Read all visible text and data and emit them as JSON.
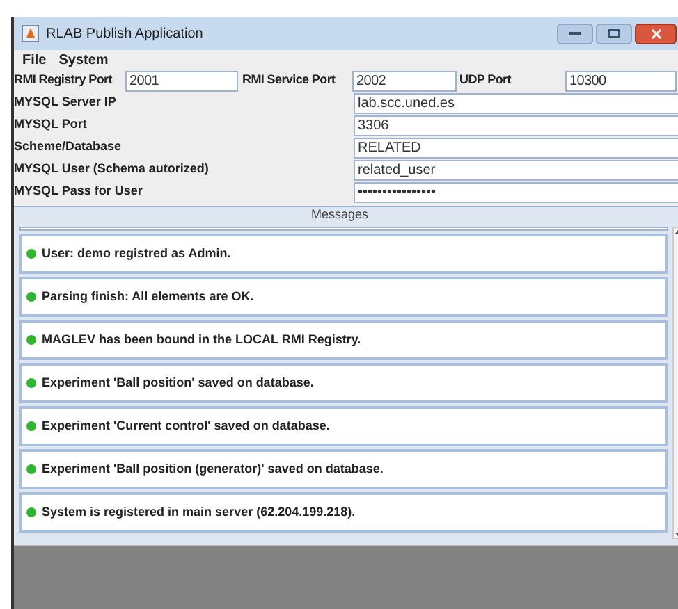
{
  "window": {
    "title": "RLAB Publish Application"
  },
  "menu": [
    "File",
    "System"
  ],
  "ports": [
    {
      "label": "RMI Registry Port",
      "value": "2001"
    },
    {
      "label": "RMI Service Port",
      "value": "2002"
    },
    {
      "label": "UDP Port",
      "value": "10300"
    }
  ],
  "settings": [
    {
      "label": "MYSQL Server IP",
      "value": "lab.scc.uned.es"
    },
    {
      "label": "MYSQL Port",
      "value": "3306"
    },
    {
      "label": "Scheme/Database",
      "value": "RELATED"
    },
    {
      "label": "MYSQL User (Schema autorized)",
      "value": "related_user"
    },
    {
      "label": "MYSQL Pass for User",
      "value": "••••••••••••••••"
    }
  ],
  "messages_panel": {
    "title": "Messages",
    "items": [
      {
        "text": "User: demo registred as Admin.",
        "color": "#2fb52f"
      },
      {
        "text": "Parsing finish: All elements are OK.",
        "color": "#2fb52f"
      },
      {
        "text": "MAGLEV has been bound in the LOCAL RMI Registry.",
        "color": "#2fb52f"
      },
      {
        "text": "Experiment 'Ball position' saved on database.",
        "color": "#2fb52f"
      },
      {
        "text": "Experiment 'Current control' saved on database.",
        "color": "#2fb52f"
      },
      {
        "text": "Experiment 'Ball position (generator)' saved on database.",
        "color": "#2fb52f"
      },
      {
        "text": "System is registered in main server (62.204.199.218).",
        "color": "#2fb52f"
      }
    ]
  }
}
